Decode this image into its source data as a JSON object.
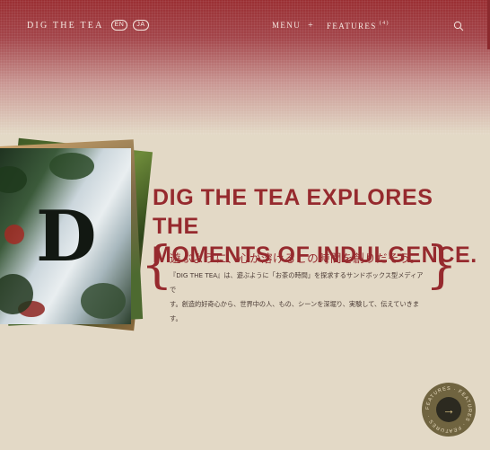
{
  "header": {
    "logo": "DIG THE TEA",
    "lang_en": "EN",
    "lang_ja": "JA",
    "menu_label": "MENU",
    "menu_plus": "+",
    "features_label": "FEATURES",
    "features_count": "(4)",
    "search_icon": "search-icon"
  },
  "hero": {
    "image_letter": "D",
    "headline_line1": "DIG THE TEA EXPLORES THE",
    "headline_line2": "MOMENTS OF INDULGENCE.",
    "brace_left": "{",
    "brace_right": "}",
    "subtitle_jp": "遊ぶように、心が溶けるこの時間を創りだそう。",
    "description_line1": "『DIG THE TEA』は、遊ぶように「お茶の時間」を探求するサンドボックス型メディアで",
    "description_line2": "す。創造的好奇心から、世界中の人、もの、シーンを深堀り、実験して、伝えていきます。"
  },
  "features_button": {
    "ring_text": "FEATURES · FEATURES · FEATURES ·",
    "arrow": "→"
  },
  "colors": {
    "accent": "#962a2e",
    "background": "#e3d9c6",
    "header_top": "#9a2f33",
    "button_bg": "#706440"
  }
}
